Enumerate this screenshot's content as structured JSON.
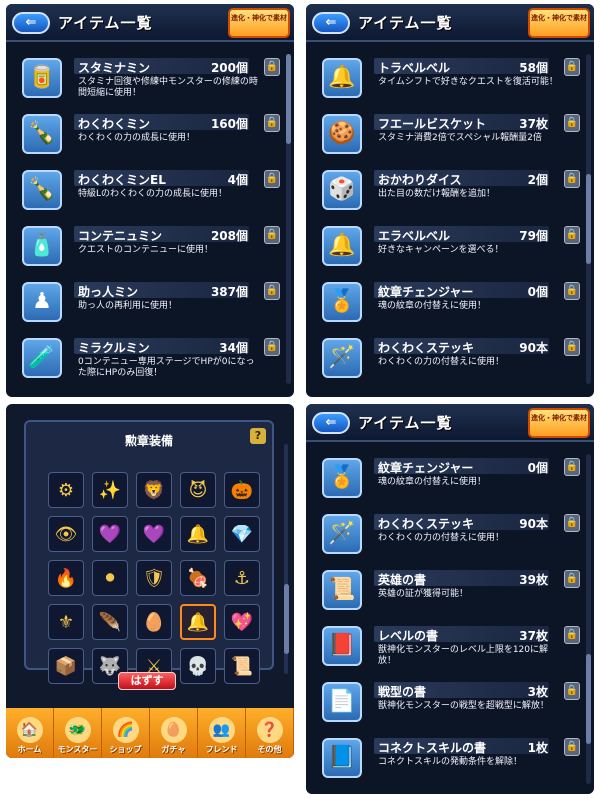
{
  "header": {
    "back_label": "⇐",
    "title": "アイテム一覧",
    "badge_label": "進化・神化で素材"
  },
  "panel1": [
    {
      "icon": "stamina-can-icon",
      "glyph": "🥫",
      "name": "スタミナミン",
      "count": "200個",
      "desc": "スタミナ回復や修練中モンスターの修練の時間短縮に使用！"
    },
    {
      "icon": "drink-bottle-icon",
      "glyph": "🍾",
      "name": "わくわくミン",
      "count": "160個",
      "desc": "わくわくの力の成長に使用！"
    },
    {
      "icon": "drink-bottle-el-icon",
      "glyph": "🍾",
      "name": "わくわくミンEL",
      "count": "4個",
      "desc": "特級Lのわくわくの力の成長に使用！"
    },
    {
      "icon": "continue-bottle-icon",
      "glyph": "🧴",
      "name": "コンテニュミン",
      "count": "208個",
      "desc": "クエストのコンテニューに使用！"
    },
    {
      "icon": "helper-pawn-icon",
      "glyph": "♟",
      "name": "助っ人ミン",
      "count": "387個",
      "desc": "助っ人の再利用に使用！"
    },
    {
      "icon": "miracle-potion-icon",
      "glyph": "🧪",
      "name": "ミラクルミン",
      "count": "34個",
      "desc": "0コンテニュー専用ステージでHPが0になった際にHPのみ回復！"
    }
  ],
  "panel2": [
    {
      "icon": "travel-bell-icon",
      "glyph": "🔔",
      "name": "トラベルベル",
      "count": "58個",
      "desc": "タイムシフトで好きなクエストを復活可能！"
    },
    {
      "icon": "biscuit-icon",
      "glyph": "🍪",
      "name": "フエールビスケット",
      "count": "37枚",
      "desc": "スタミナ消費2倍でスペシャル報酬量2倍"
    },
    {
      "icon": "dice-icon",
      "glyph": "🎲",
      "name": "おかわりダイス",
      "count": "2個",
      "desc": "出た目の数だけ報酬を追加！"
    },
    {
      "icon": "select-bell-icon",
      "glyph": "🔔",
      "name": "エラベルベル",
      "count": "79個",
      "desc": "好きなキャンペーンを選べる！"
    },
    {
      "icon": "medal-changer-icon",
      "glyph": "🏅",
      "name": "紋章チェンジャー",
      "count": "0個",
      "desc": "魂の紋章の付替えに使用！"
    },
    {
      "icon": "waku-stick-icon",
      "glyph": "🪄",
      "name": "わくわくステッキ",
      "count": "90本",
      "desc": "わくわくの力の付替えに使用！"
    }
  ],
  "panel2_title": "アイテム一覧",
  "panel3": {
    "title": "勲章装備",
    "help_label": "?",
    "remove_label": "はずす",
    "medals": [
      "⚙",
      "✨",
      "🦁",
      "😈",
      "🎃",
      "👁",
      "💜",
      "💜",
      "🔔",
      "💎",
      "🔥",
      "⚫",
      "🛡",
      "🍖",
      "⚓",
      "⚜",
      "🪶",
      "🥚",
      "🔔",
      "💖",
      "📦",
      "🐺",
      "⚔",
      "💀",
      "📜"
    ],
    "tabs": [
      {
        "icon": "home-icon",
        "glyph": "🏠",
        "label": "ホーム"
      },
      {
        "icon": "monster-icon",
        "glyph": "🐲",
        "label": "モンスター"
      },
      {
        "icon": "shop-icon",
        "glyph": "🌈",
        "label": "ショップ"
      },
      {
        "icon": "gacha-icon",
        "glyph": "🥚",
        "label": "ガチャ"
      },
      {
        "icon": "friend-icon",
        "glyph": "👥",
        "label": "フレンド"
      },
      {
        "icon": "other-icon",
        "glyph": "❓",
        "label": "その他"
      }
    ]
  },
  "panel4": [
    {
      "icon": "medal-changer-icon",
      "glyph": "🏅",
      "name": "紋章チェンジャー",
      "count": "0個",
      "desc": "魂の紋章の付替えに使用！"
    },
    {
      "icon": "waku-stick-icon",
      "glyph": "🪄",
      "name": "わくわくステッキ",
      "count": "90本",
      "desc": "わくわくの力の付替えに使用！"
    },
    {
      "icon": "hero-book-icon",
      "glyph": "📜",
      "name": "英雄の書",
      "count": "39枚",
      "desc": "英雄の証が獲得可能！"
    },
    {
      "icon": "level-book-icon",
      "glyph": "📕",
      "name": "レベルの書",
      "count": "37枚",
      "desc": "獣神化モンスターのレベル上限を120に解放！"
    },
    {
      "icon": "type-book-icon",
      "glyph": "📄",
      "name": "戦型の書",
      "count": "3枚",
      "desc": "獣神化モンスターの戦型を超戦型に解放！"
    },
    {
      "icon": "connect-skill-book-icon",
      "glyph": "📘",
      "name": "コネクトスキルの書",
      "count": "1枚",
      "desc": "コネクトスキルの発動条件を解除！"
    }
  ]
}
